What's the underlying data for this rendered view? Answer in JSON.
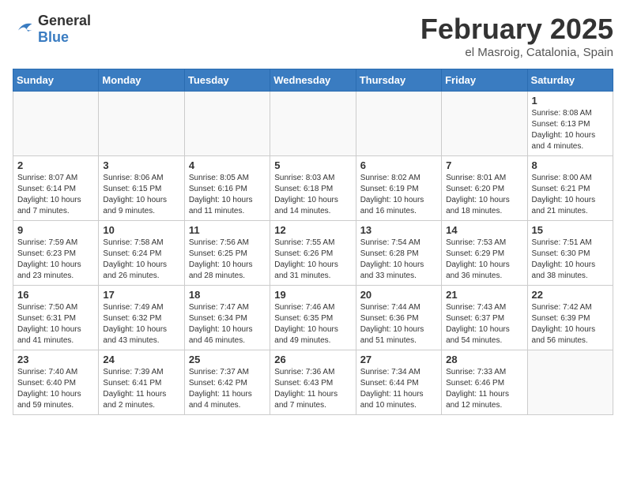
{
  "header": {
    "logo": {
      "general": "General",
      "blue": "Blue"
    },
    "title": "February 2025",
    "location": "el Masroig, Catalonia, Spain"
  },
  "days_of_week": [
    "Sunday",
    "Monday",
    "Tuesday",
    "Wednesday",
    "Thursday",
    "Friday",
    "Saturday"
  ],
  "weeks": [
    [
      {
        "day": "",
        "info": ""
      },
      {
        "day": "",
        "info": ""
      },
      {
        "day": "",
        "info": ""
      },
      {
        "day": "",
        "info": ""
      },
      {
        "day": "",
        "info": ""
      },
      {
        "day": "",
        "info": ""
      },
      {
        "day": "1",
        "info": "Sunrise: 8:08 AM\nSunset: 6:13 PM\nDaylight: 10 hours and 4 minutes."
      }
    ],
    [
      {
        "day": "2",
        "info": "Sunrise: 8:07 AM\nSunset: 6:14 PM\nDaylight: 10 hours and 7 minutes."
      },
      {
        "day": "3",
        "info": "Sunrise: 8:06 AM\nSunset: 6:15 PM\nDaylight: 10 hours and 9 minutes."
      },
      {
        "day": "4",
        "info": "Sunrise: 8:05 AM\nSunset: 6:16 PM\nDaylight: 10 hours and 11 minutes."
      },
      {
        "day": "5",
        "info": "Sunrise: 8:03 AM\nSunset: 6:18 PM\nDaylight: 10 hours and 14 minutes."
      },
      {
        "day": "6",
        "info": "Sunrise: 8:02 AM\nSunset: 6:19 PM\nDaylight: 10 hours and 16 minutes."
      },
      {
        "day": "7",
        "info": "Sunrise: 8:01 AM\nSunset: 6:20 PM\nDaylight: 10 hours and 18 minutes."
      },
      {
        "day": "8",
        "info": "Sunrise: 8:00 AM\nSunset: 6:21 PM\nDaylight: 10 hours and 21 minutes."
      }
    ],
    [
      {
        "day": "9",
        "info": "Sunrise: 7:59 AM\nSunset: 6:23 PM\nDaylight: 10 hours and 23 minutes."
      },
      {
        "day": "10",
        "info": "Sunrise: 7:58 AM\nSunset: 6:24 PM\nDaylight: 10 hours and 26 minutes."
      },
      {
        "day": "11",
        "info": "Sunrise: 7:56 AM\nSunset: 6:25 PM\nDaylight: 10 hours and 28 minutes."
      },
      {
        "day": "12",
        "info": "Sunrise: 7:55 AM\nSunset: 6:26 PM\nDaylight: 10 hours and 31 minutes."
      },
      {
        "day": "13",
        "info": "Sunrise: 7:54 AM\nSunset: 6:28 PM\nDaylight: 10 hours and 33 minutes."
      },
      {
        "day": "14",
        "info": "Sunrise: 7:53 AM\nSunset: 6:29 PM\nDaylight: 10 hours and 36 minutes."
      },
      {
        "day": "15",
        "info": "Sunrise: 7:51 AM\nSunset: 6:30 PM\nDaylight: 10 hours and 38 minutes."
      }
    ],
    [
      {
        "day": "16",
        "info": "Sunrise: 7:50 AM\nSunset: 6:31 PM\nDaylight: 10 hours and 41 minutes."
      },
      {
        "day": "17",
        "info": "Sunrise: 7:49 AM\nSunset: 6:32 PM\nDaylight: 10 hours and 43 minutes."
      },
      {
        "day": "18",
        "info": "Sunrise: 7:47 AM\nSunset: 6:34 PM\nDaylight: 10 hours and 46 minutes."
      },
      {
        "day": "19",
        "info": "Sunrise: 7:46 AM\nSunset: 6:35 PM\nDaylight: 10 hours and 49 minutes."
      },
      {
        "day": "20",
        "info": "Sunrise: 7:44 AM\nSunset: 6:36 PM\nDaylight: 10 hours and 51 minutes."
      },
      {
        "day": "21",
        "info": "Sunrise: 7:43 AM\nSunset: 6:37 PM\nDaylight: 10 hours and 54 minutes."
      },
      {
        "day": "22",
        "info": "Sunrise: 7:42 AM\nSunset: 6:39 PM\nDaylight: 10 hours and 56 minutes."
      }
    ],
    [
      {
        "day": "23",
        "info": "Sunrise: 7:40 AM\nSunset: 6:40 PM\nDaylight: 10 hours and 59 minutes."
      },
      {
        "day": "24",
        "info": "Sunrise: 7:39 AM\nSunset: 6:41 PM\nDaylight: 11 hours and 2 minutes."
      },
      {
        "day": "25",
        "info": "Sunrise: 7:37 AM\nSunset: 6:42 PM\nDaylight: 11 hours and 4 minutes."
      },
      {
        "day": "26",
        "info": "Sunrise: 7:36 AM\nSunset: 6:43 PM\nDaylight: 11 hours and 7 minutes."
      },
      {
        "day": "27",
        "info": "Sunrise: 7:34 AM\nSunset: 6:44 PM\nDaylight: 11 hours and 10 minutes."
      },
      {
        "day": "28",
        "info": "Sunrise: 7:33 AM\nSunset: 6:46 PM\nDaylight: 11 hours and 12 minutes."
      },
      {
        "day": "",
        "info": ""
      }
    ]
  ]
}
